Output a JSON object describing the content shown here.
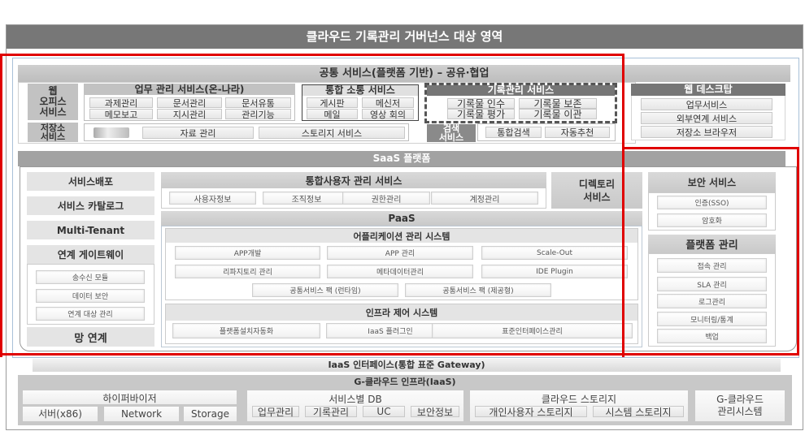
{
  "title": "클라우드 기록관리 거버넌스 대상 영역",
  "common_services": {
    "header": "공통 서비스(플랫폼 기반) – 공유·협업",
    "web_office": {
      "label": "웹\n오피스\n서비스"
    },
    "storage_service": {
      "label": "저장소\n서비스",
      "items": [
        "자료 관리",
        "스토리지 서비스"
      ]
    },
    "work_mgmt": {
      "label": "업무 관리 서비스(온-나라)",
      "items": [
        "과제관리",
        "문서관리",
        "문서유통",
        "메모보고",
        "지시관리",
        "관리기능"
      ]
    },
    "communication": {
      "label": "통합 소통 서비스",
      "items": [
        "게시판",
        "메신저",
        "메일",
        "영상 회의"
      ]
    },
    "records_mgmt": {
      "label": "기록관리 서비스",
      "items": [
        "기록물 인수",
        "기록물 보존",
        "기록물 평가",
        "기록물 이관"
      ]
    },
    "search": {
      "label": "검색\n서비스",
      "items": [
        "통합검색",
        "자동추천"
      ]
    },
    "web_desktop": {
      "label": "웹 데스크탑",
      "items": [
        "업무서비스",
        "외부연계 서비스",
        "저장소 브라우저"
      ]
    }
  },
  "saas": {
    "header": "SaaS 플랫폼",
    "left_items": [
      "서비스배포",
      "서비스 카탈로그",
      "Multi-Tenant"
    ],
    "gateway": {
      "label": "연계 게이트웨이",
      "items": [
        "송수신 모듈",
        "데이터 보안",
        "연계 대상 관리"
      ]
    },
    "network": "망 연계",
    "user_mgmt": {
      "label": "통합사용자 관리 서비스",
      "items": [
        "사용자정보",
        "조직정보",
        "권한관리",
        "계정관리"
      ]
    },
    "directory": "디렉토리\n서비스",
    "paas": {
      "label": "PaaS",
      "app_mgmt": {
        "label": "어플리케이션 관리 시스템",
        "items": [
          "APP개발",
          "APP 관리",
          "Scale-Out",
          "리파지토리 관리",
          "메타데이터관리",
          "IDE Plugin"
        ],
        "packs": [
          "공통서비스 팩 (런타임)",
          "공통서비스 팩 (제공형)"
        ]
      },
      "infra_ctrl": {
        "label": "인프라 제어 시스템",
        "items": [
          "플랫폼설치자동화",
          "IaaS 플러그인",
          "표준인터페이스관리"
        ]
      }
    },
    "security": {
      "label": "보안 서비스",
      "items": [
        "인증(SSO)",
        "암호화"
      ]
    },
    "platform_mgmt": {
      "label": "플랫폼 관리",
      "items": [
        "접속 관리",
        "SLA 관리",
        "로그관리",
        "모니터링/통계",
        "백업"
      ]
    }
  },
  "iaas_interface": "IaaS 인터페이스(통합 표준 Gateway)",
  "gcloud": {
    "header": "G-클라우드 인프라(IaaS)",
    "hypervisor": {
      "label": "하이퍼바이저",
      "items": [
        "서버(x86)",
        "Network",
        "Storage"
      ]
    },
    "service_db": {
      "label": "서비스별 DB",
      "items": [
        "업무관리",
        "기록관리",
        "UC",
        "보안정보"
      ]
    },
    "cloud_storage": {
      "label": "클라우드 스토리지",
      "items": [
        "개인사용자 스토리지",
        "시스템 스토리지"
      ]
    },
    "mgmt_system": "G-클라우드\n관리시스템"
  },
  "colors": {
    "highlight_frame": "#e00000",
    "title_bar": "#777777",
    "label_gray": "#c2c2c2"
  }
}
